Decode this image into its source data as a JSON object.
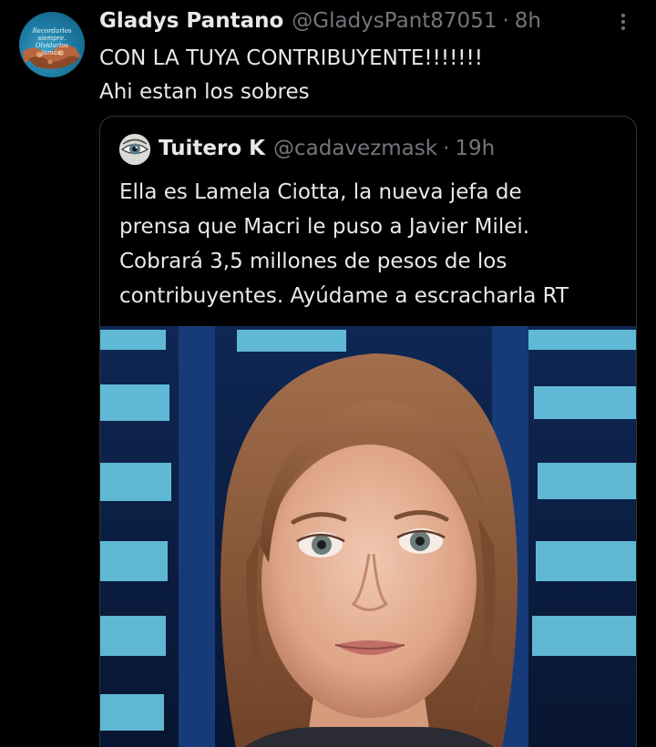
{
  "tweet": {
    "author_name": "Gladys Pantano",
    "author_handle": "@GladysPant87051",
    "separator": "·",
    "time": "8h",
    "lines": [
      "CON LA TUYA CONTRIBUYENTE!!!!!!!",
      "Ahi estan los sobres"
    ],
    "avatar_text": [
      "Recordarlos siempre.",
      "Olvidarlos jamás."
    ],
    "more_icon": "more-vertical-icon"
  },
  "quote": {
    "author_name": "Tuitero K",
    "author_handle": "@cadavezmask",
    "separator": "·",
    "time": "19h",
    "lines": [
      "Ella es Lamela Ciotta, la nueva jefa de",
      "prensa que Macri le puso a Javier Milei.",
      "Cobrará 3,5 millones de pesos de los",
      "contribuyentes. Ayúdame a escracharla RT"
    ]
  },
  "colors": {
    "background": "#000000",
    "text_primary": "#e7e9ea",
    "text_secondary": "#71767b",
    "border": "#2f3336"
  }
}
